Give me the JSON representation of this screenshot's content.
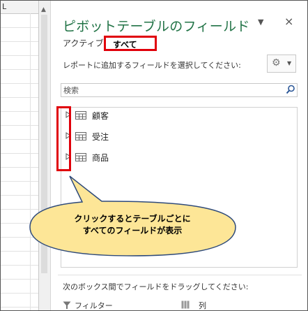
{
  "sheet": {
    "col_header": "L"
  },
  "pane": {
    "title": "ピボットテーブルのフィールド",
    "menu_glyph": "▼",
    "close_glyph": "×",
    "tabs": [
      {
        "label": "アクティブ"
      },
      {
        "label": "すべて"
      }
    ],
    "instruction": "レポートに追加するフィールドを選択してください:",
    "gear_icon": "gear-icon",
    "gear_glyph": "⚙",
    "caret_glyph": "▼",
    "search": {
      "placeholder": "検索",
      "icon": "search-icon"
    },
    "fields": [
      {
        "label": "顧客"
      },
      {
        "label": "受注"
      },
      {
        "label": "商品"
      }
    ],
    "drag_instruction": "次のボックス間でフィールドをドラッグしてください:",
    "areas": {
      "filter_label": "フィルター",
      "column_label": "列"
    }
  },
  "callout": {
    "line1": "クリックするとテーブルごとに",
    "line2": "すべてのフィールドが表示"
  },
  "colors": {
    "title_green": "#217346",
    "highlight_red": "#e0000a",
    "callout_fill": "#fde697",
    "callout_border": "#2e4a7a"
  }
}
